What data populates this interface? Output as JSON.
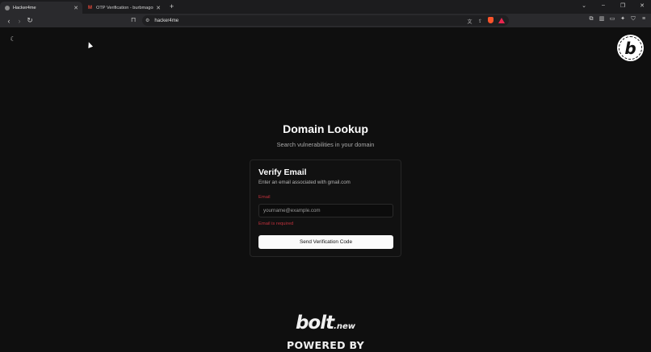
{
  "browser": {
    "tabs": [
      {
        "title": "Hacker4me",
        "active": true
      },
      {
        "title": "OTP Verification - burbmagomez@gm",
        "active": false
      }
    ],
    "new_tab_label": "+",
    "url": "hacker4me",
    "window_controls": {
      "dropdown": "⌄",
      "minimize": "–",
      "restore": "❐",
      "close": "✕"
    }
  },
  "page": {
    "title": "Domain Lookup",
    "subtitle": "Search vulnerabilities in your domain",
    "card": {
      "title": "Verify Email",
      "description": "Enter an email associated with gmail.com",
      "email_label": "Email",
      "email_placeholder": "yourname@example.com",
      "email_value": "",
      "error_text": "Email is required",
      "submit_label": "Send Verification Code"
    },
    "footer": {
      "logo_main": "bolt",
      "logo_suffix": ".new",
      "powered_by": "POWERED BY"
    }
  },
  "colors": {
    "background": "#0f0f0f",
    "card_border": "#262626",
    "error": "#c0313c",
    "button_bg": "#fafafa"
  },
  "icons": {
    "theme_toggle": "moon-icon",
    "badge": "bolt-badge-icon"
  }
}
